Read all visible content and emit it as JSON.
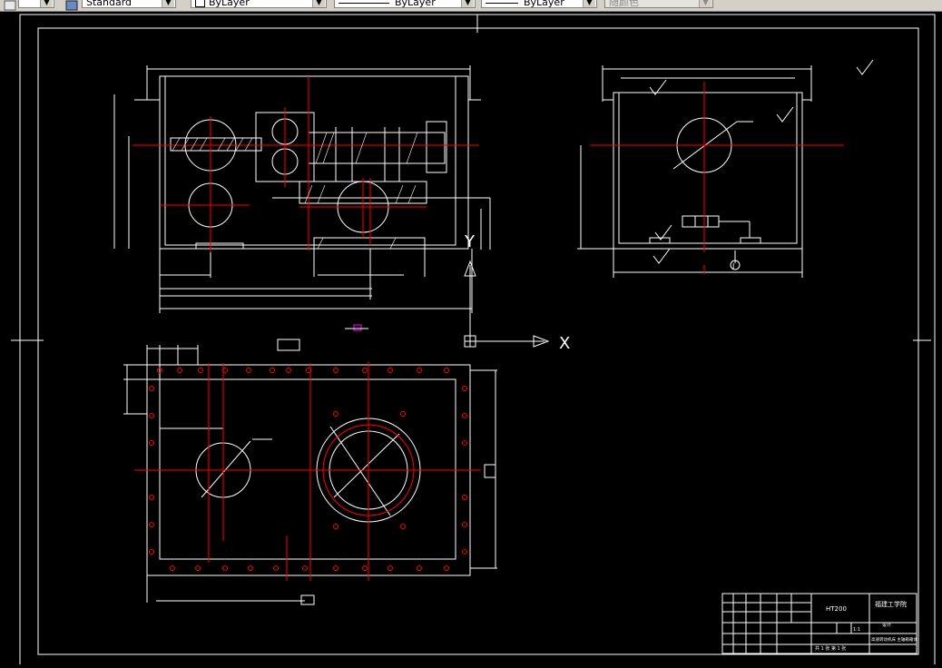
{
  "toolbar": {
    "text_style": "Standard",
    "layer_control": "ByLayer",
    "linetype": "ByLayer",
    "lineweight": "ByLayer",
    "plot_style": "随颜色"
  },
  "colors": {
    "background": "#000000",
    "lines": "#ffffff",
    "centerlines": "#ff0000",
    "accent": "#ff00ff"
  },
  "ucs": {
    "x_label": "X",
    "y_label": "Y"
  },
  "detail_marker": "I",
  "title_block": {
    "school": "福建工学院",
    "material": "HT200",
    "ratio": "1:1",
    "sheet": "共 1 张 第 1 张",
    "drawing_name": "高速转动机床 主轴箱箱体",
    "stage": "设计"
  },
  "icons": [
    "text-style-icon",
    "layer-icon"
  ]
}
